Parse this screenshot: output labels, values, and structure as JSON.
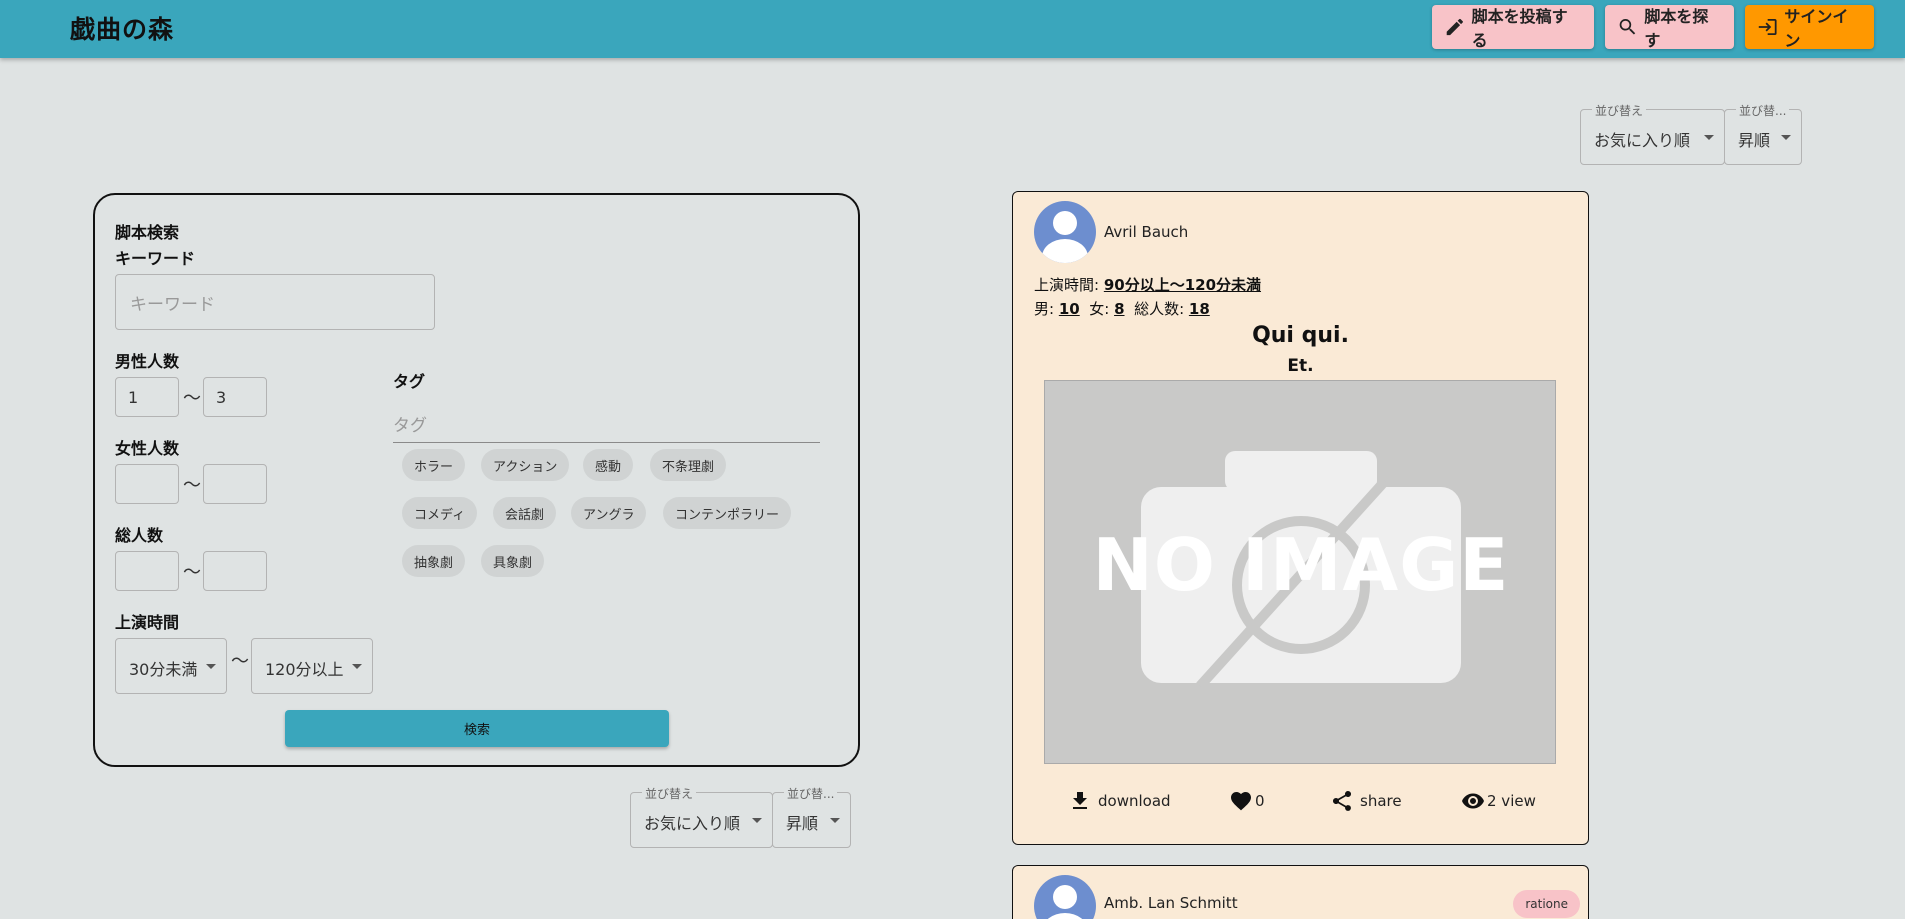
{
  "header": {
    "logo": "戯曲の森",
    "post_label": "脚本を投稿する",
    "find_label": "脚本を探す",
    "signin_label": "サインイン"
  },
  "sort_top": {
    "sort_label": "並び替え",
    "sort_value": "お気に入り順",
    "order_label": "並び替...",
    "order_value": "昇順"
  },
  "sort_bottom": {
    "sort_label": "並び替え",
    "sort_value": "お気に入り順",
    "order_label": "並び替...",
    "order_value": "昇順"
  },
  "search": {
    "title": "脚本検索",
    "keyword_label": "キーワード",
    "keyword_placeholder": "キーワード",
    "male_label": "男性人数",
    "male_min": "1",
    "male_max": "3",
    "female_label": "女性人数",
    "female_min": "",
    "female_max": "",
    "total_label": "総人数",
    "total_min": "",
    "total_max": "",
    "tilde": "〜",
    "time_label": "上演時間",
    "time_min": "30分未満",
    "time_max": "120分以上",
    "tag_label": "タグ",
    "tag_placeholder": "タグ",
    "tags": [
      "ホラー",
      "アクション",
      "感動",
      "不条理劇",
      "コメディ",
      "会話劇",
      "アングラ",
      "コンテンポラリー",
      "抽象劇",
      "具象劇"
    ],
    "submit_label": "検索"
  },
  "card": {
    "author": "Avril Bauch",
    "time_prefix": "上演時間: ",
    "time_value": "90分以上〜120分未満",
    "male_prefix": "男: ",
    "male_value": "10",
    "female_prefix": "女: ",
    "female_value": "8",
    "total_prefix": "総人数: ",
    "total_value": "18",
    "title": "Qui qui.",
    "subtitle": "Et.",
    "image_text": "NO IMAGE",
    "download_label": "download",
    "likes": "0",
    "share_label": "share",
    "views": "2 view"
  },
  "card2": {
    "author": "Amb. Lan Schmitt",
    "badge": "ratione"
  },
  "colors": {
    "appbar": "#3aa6bc",
    "pink_button": "#f8c3c8",
    "orange_button": "#ff9800",
    "card_bg": "#faead6",
    "page_bg": "#dfe3e3"
  }
}
